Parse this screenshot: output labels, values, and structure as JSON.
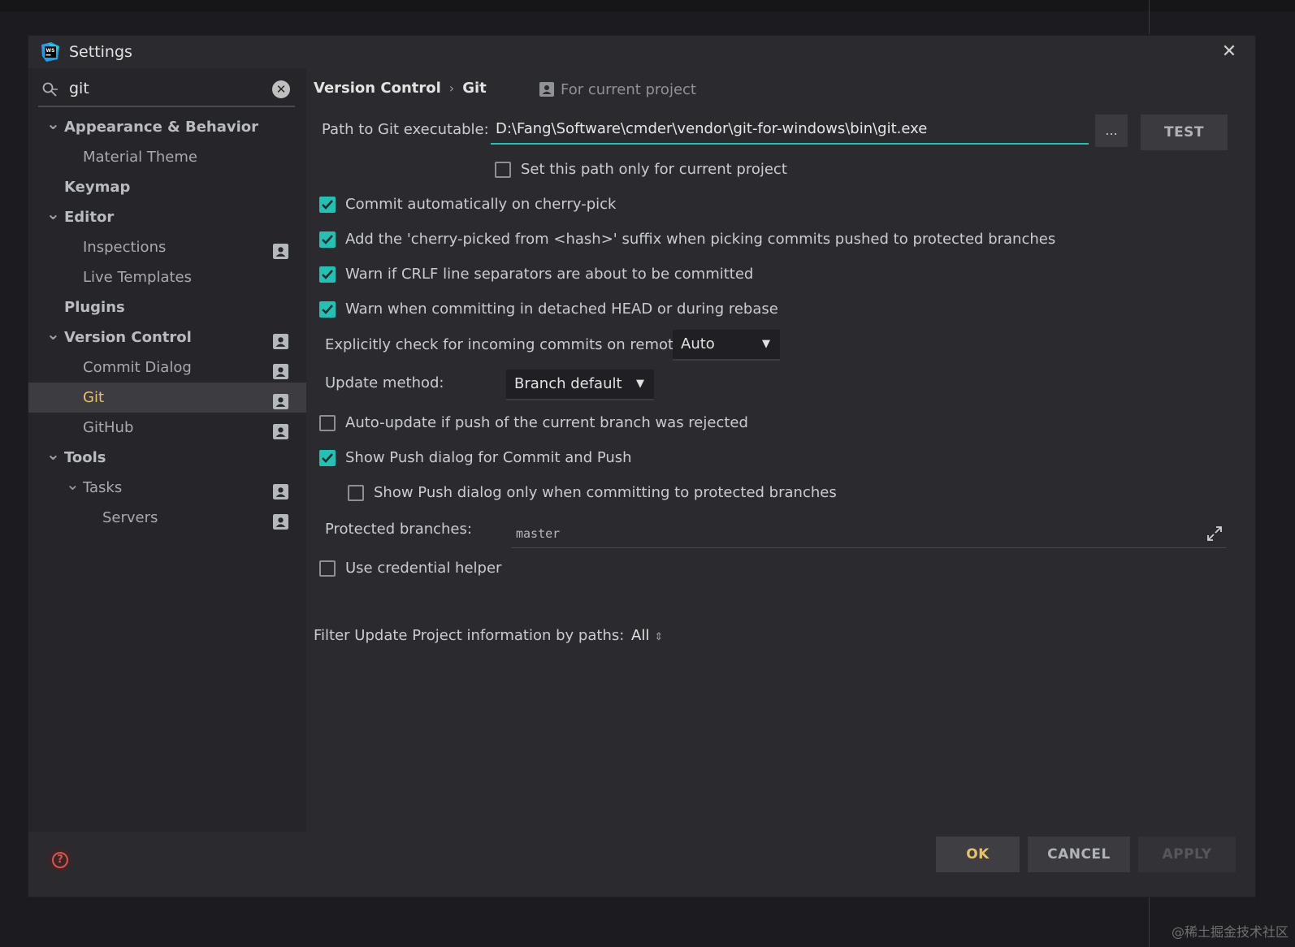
{
  "window": {
    "title": "Settings",
    "close_label": "✕"
  },
  "search": {
    "value": "git",
    "clear_label": "✕"
  },
  "tree": [
    {
      "label": "Appearance & Behavior",
      "level": 0,
      "bold": true,
      "expandable": true,
      "project": false,
      "selected": false
    },
    {
      "label": "Material Theme",
      "level": 1,
      "bold": false,
      "expandable": false,
      "project": false,
      "selected": false
    },
    {
      "label": "Keymap",
      "level": 0,
      "bold": true,
      "expandable": false,
      "project": false,
      "selected": false
    },
    {
      "label": "Editor",
      "level": 0,
      "bold": true,
      "expandable": true,
      "project": false,
      "selected": false
    },
    {
      "label": "Inspections",
      "level": 1,
      "bold": false,
      "expandable": false,
      "project": true,
      "selected": false
    },
    {
      "label": "Live Templates",
      "level": 1,
      "bold": false,
      "expandable": false,
      "project": false,
      "selected": false
    },
    {
      "label": "Plugins",
      "level": 0,
      "bold": true,
      "expandable": false,
      "project": false,
      "selected": false
    },
    {
      "label": "Version Control",
      "level": 0,
      "bold": true,
      "expandable": true,
      "project": true,
      "selected": false
    },
    {
      "label": "Commit Dialog",
      "level": 1,
      "bold": false,
      "expandable": false,
      "project": true,
      "selected": false
    },
    {
      "label": "Git",
      "level": 1,
      "bold": false,
      "expandable": false,
      "project": true,
      "selected": true
    },
    {
      "label": "GitHub",
      "level": 1,
      "bold": false,
      "expandable": false,
      "project": true,
      "selected": false
    },
    {
      "label": "Tools",
      "level": 0,
      "bold": true,
      "expandable": true,
      "project": false,
      "selected": false
    },
    {
      "label": "Tasks",
      "level": 1,
      "bold": false,
      "expandable": true,
      "project": true,
      "selected": false
    },
    {
      "label": "Servers",
      "level": 2,
      "bold": false,
      "expandable": false,
      "project": true,
      "selected": false
    }
  ],
  "breadcrumb": {
    "parent": "Version Control",
    "separator": "›",
    "current": "Git",
    "scope": "For current project"
  },
  "git": {
    "path_label": "Path to Git executable:",
    "path_value": "D:\\Fang\\Software\\cmder\\vendor\\git-for-windows\\bin\\git.exe",
    "browse_label": "...",
    "test_label": "TEST",
    "path_only_project": {
      "label": "Set this path only for current project",
      "checked": false
    },
    "checkboxes": [
      {
        "label": "Commit automatically on cherry-pick",
        "checked": true
      },
      {
        "label": "Add the 'cherry-picked from <hash>' suffix when picking commits pushed to protected branches",
        "checked": true
      },
      {
        "label": "Warn if CRLF line separators are about to be committed",
        "checked": true
      },
      {
        "label": "Warn when committing in detached HEAD or during rebase",
        "checked": true
      }
    ],
    "incoming_label": "Explicitly check for incoming commits on remotes:",
    "incoming_value": "Auto",
    "update_method_label": "Update method:",
    "update_method_value": "Branch default",
    "auto_update": {
      "label": "Auto-update if push of the current branch was rejected",
      "checked": false
    },
    "show_push": {
      "label": "Show Push dialog for Commit and Push",
      "checked": true
    },
    "show_push_protected": {
      "label": "Show Push dialog only when committing to protected branches",
      "checked": false
    },
    "protected_label": "Protected branches:",
    "protected_value": "master",
    "credential_helper": {
      "label": "Use credential helper",
      "checked": false
    },
    "filter_label": "Filter Update Project information by paths:",
    "filter_value": "All"
  },
  "footer": {
    "help_label": "?",
    "ok_label": "OK",
    "cancel_label": "CANCEL",
    "apply_label": "APPLY",
    "apply_enabled": false
  },
  "watermark": "@稀土掘金技术社区",
  "colors": {
    "accent_teal": "#21c2b4",
    "selected_text": "#e6c36a",
    "background": "#2b2b2f"
  }
}
